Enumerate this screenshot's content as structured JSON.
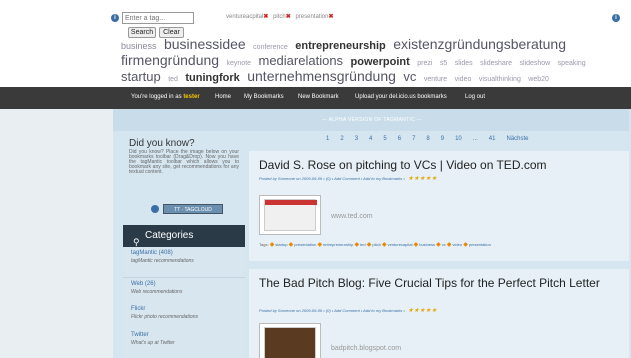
{
  "tagbar": {
    "input_placeholder": "Enter a tag...",
    "search_label": "Search",
    "clear_label": "Clear",
    "info_left": "i",
    "info_right": "i",
    "active_tags": [
      "ventureacpital",
      "pitch",
      "presentation"
    ]
  },
  "cloud": [
    {
      "t": "business",
      "s": "s2"
    },
    {
      "t": "businessidee",
      "s": "s5"
    },
    {
      "t": "conference",
      "s": "s1"
    },
    {
      "t": "entrepreneurship",
      "s": "s3 b"
    },
    {
      "t": "existenzgründungsberatung",
      "s": "s5"
    },
    {
      "t": "firmengründung",
      "s": "s5"
    },
    {
      "t": "keynote",
      "s": "s1"
    },
    {
      "t": "mediarelations",
      "s": "s4"
    },
    {
      "t": "powerpoint",
      "s": "s3 b"
    },
    {
      "t": "prezi",
      "s": "s1"
    },
    {
      "t": "s5",
      "s": "s1"
    },
    {
      "t": "slides",
      "s": "s1"
    },
    {
      "t": "slideshare",
      "s": "s1"
    },
    {
      "t": "slideshow",
      "s": "s1"
    },
    {
      "t": "speaking",
      "s": "s1"
    },
    {
      "t": "startup",
      "s": "s4"
    },
    {
      "t": "ted",
      "s": "s1"
    },
    {
      "t": "tuningfork",
      "s": "s3 b"
    },
    {
      "t": "unternehmensgründung",
      "s": "s5"
    },
    {
      "t": "vc",
      "s": "s4"
    },
    {
      "t": "venture",
      "s": "s1"
    },
    {
      "t": "video",
      "s": "s1"
    },
    {
      "t": "visualthinking",
      "s": "s1"
    },
    {
      "t": "web20",
      "s": "s1"
    },
    {
      "t": "wirtschaftsförderung",
      "s": "s5"
    }
  ],
  "nav": {
    "logged_in_prefix": "You're logged in as",
    "user": "tester",
    "home": "Home",
    "my_bookmarks": "My Bookmarks",
    "new_bookmark": "New Bookmark",
    "upload": "Upload your del.icio.us bookmarks",
    "logout": "Log out"
  },
  "alpha_banner": "— ALPHA VERSION OF TAGMANTIC —",
  "sidebar": {
    "did_you_know_title": "Did you know?",
    "did_you_know_text": "Did you know? Place the image below on your bookmarks toolbar (Drag&Drop). Now you have the tagMantic toolbar which allows you to bookmark any site, get recommendations for any textual content.",
    "badge": "TT · TAGCLOUD",
    "categories_title": "Categories",
    "categories": [
      {
        "name": "tagMantic (408)",
        "desc": "tagMantic recommendations"
      },
      {
        "name": "Web (26)",
        "desc": "Web recommendations"
      },
      {
        "name": "Flickr",
        "desc": "Flickr photo recommendations"
      },
      {
        "name": "Twitter",
        "desc": "What's up at Twitter"
      }
    ]
  },
  "pager": [
    "1",
    "2",
    "3",
    "4",
    "5",
    "6",
    "7",
    "8",
    "9",
    "10",
    "...",
    "41",
    "Nächste"
  ],
  "posts": [
    {
      "title": "David S. Rose on pitching to VCs | Video on TED.com",
      "meta": "Posted by Someone on 2009-09-09 • (0) • Add Comment • Add to my Bookmarks •",
      "stars": "★★★★★",
      "site": "www.ted.com",
      "tags_label": "Tags:",
      "tags": [
        "startup",
        "presentation",
        "entrepreneurship",
        "ted",
        "pitch",
        "venturecapital",
        "business",
        "vc",
        "video",
        "presentation"
      ]
    },
    {
      "title": "The Bad Pitch Blog: Five Crucial Tips for the Perfect Pitch Letter",
      "meta": "Posted by Someone on 2009-09-09 • (0) • Add Comment • Add to my Bookmarks •",
      "stars": "★★★★★",
      "site": "badpitch.blogspot.com"
    }
  ],
  "colors": {
    "navbar": "#3a3a3a",
    "accent": "#3a6ea5",
    "highlight_user": "#f5c400",
    "category_header": "#2b3a47",
    "post_bg": "#e6f0f6",
    "tag_x": "#cc2222"
  }
}
